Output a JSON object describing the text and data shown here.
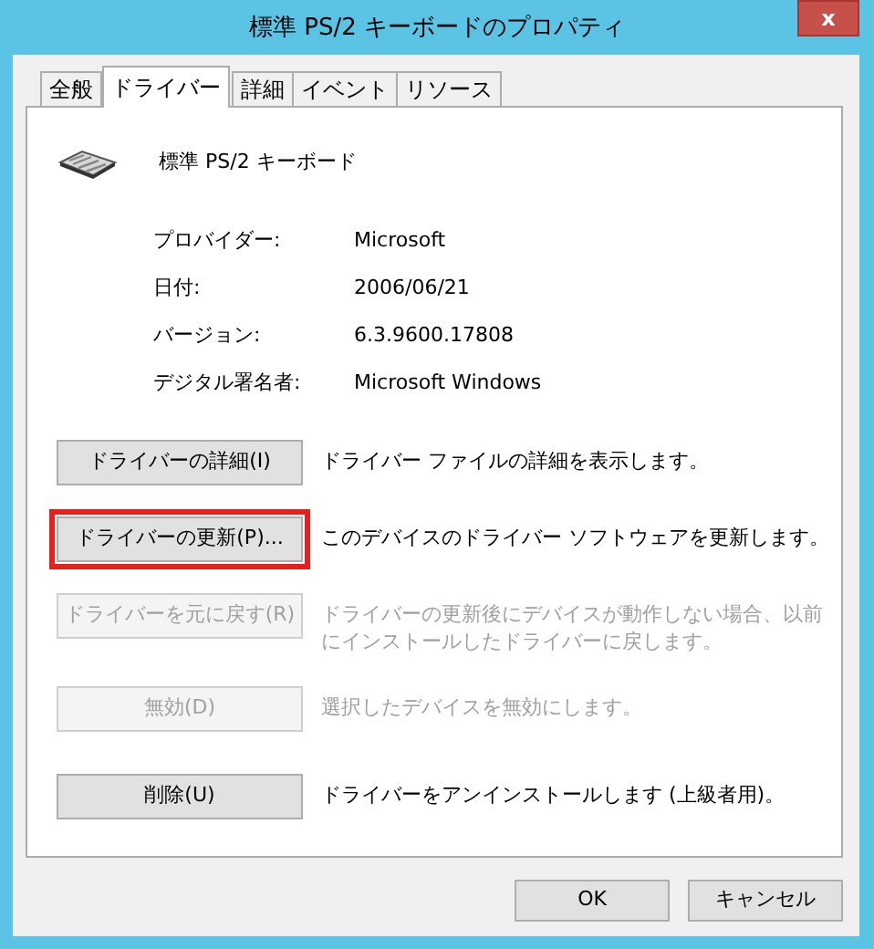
{
  "window": {
    "title": "標準 PS/2 キーボードのプロパティ",
    "close": "x"
  },
  "tabs": [
    {
      "label": "全般",
      "selected": false
    },
    {
      "label": "ドライバー",
      "selected": true
    },
    {
      "label": "詳細",
      "selected": false
    },
    {
      "label": "イベント",
      "selected": false
    },
    {
      "label": "リソース",
      "selected": false
    }
  ],
  "device": {
    "name": "標準 PS/2 キーボード"
  },
  "properties": [
    {
      "label": "プロバイダー:",
      "value": "Microsoft"
    },
    {
      "label": "日付:",
      "value": "2006/06/21"
    },
    {
      "label": "バージョン:",
      "value": "6.3.9600.17808"
    },
    {
      "label": "デジタル署名者:",
      "value": "Microsoft Windows"
    }
  ],
  "actions": [
    {
      "button": "ドライバーの詳細(I)",
      "description": "ドライバー ファイルの詳細を表示します。",
      "disabled": false,
      "highlighted": false
    },
    {
      "button": "ドライバーの更新(P)...",
      "description": "このデバイスのドライバー ソフトウェアを更新します。",
      "disabled": false,
      "highlighted": true
    },
    {
      "button": "ドライバーを元に戻す(R)",
      "description": "ドライバーの更新後にデバイスが動作しない場合、以前にインストールしたドライバーに戻します。",
      "disabled": true,
      "highlighted": false
    },
    {
      "button": "無効(D)",
      "description": "選択したデバイスを無効にします。",
      "disabled": true,
      "highlighted": false
    },
    {
      "button": "削除(U)",
      "description": "ドライバーをアンインストールします (上級者用)。",
      "disabled": false,
      "highlighted": false
    }
  ],
  "footer_buttons": [
    "OK",
    "キャンセル"
  ]
}
